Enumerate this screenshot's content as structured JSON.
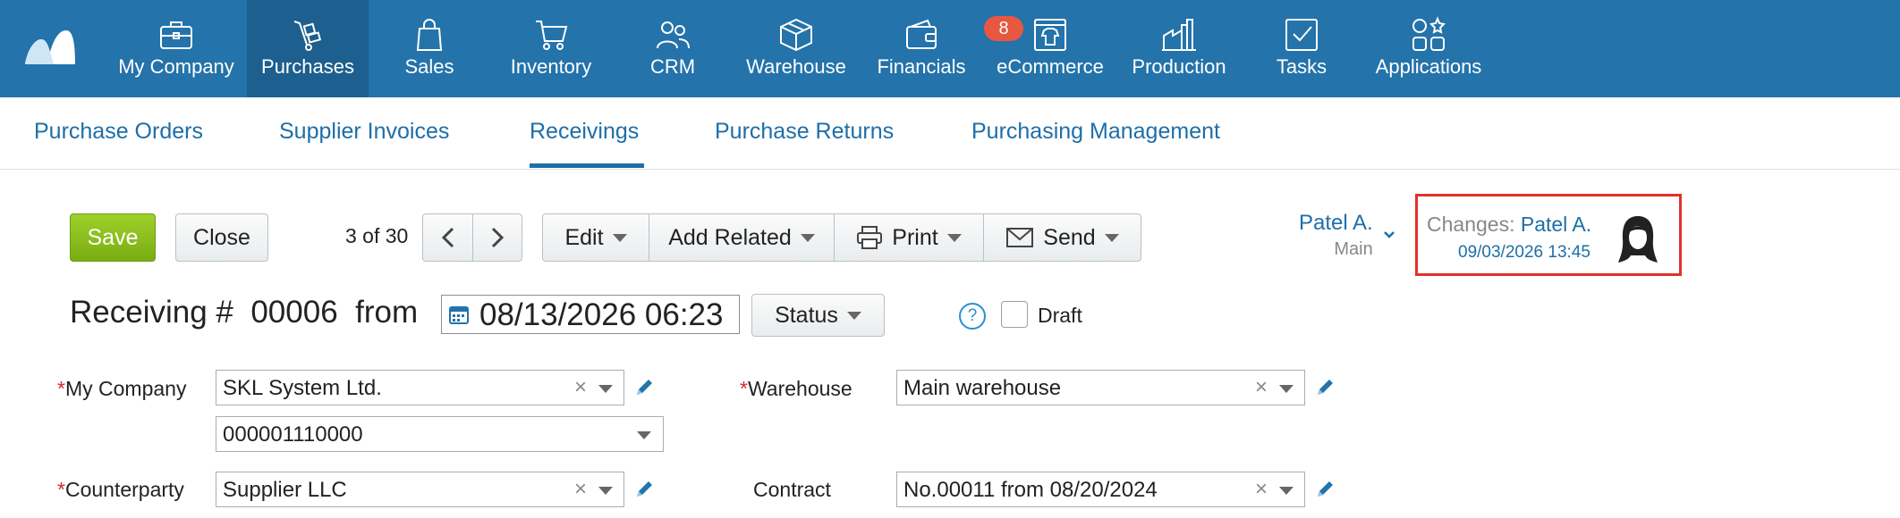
{
  "nav": [
    {
      "label": "My Company",
      "icon": "briefcase-icon"
    },
    {
      "label": "Purchases",
      "icon": "hand-truck-icon",
      "active": true
    },
    {
      "label": "Sales",
      "icon": "shopping-bag-icon"
    },
    {
      "label": "Inventory",
      "icon": "cart-icon"
    },
    {
      "label": "CRM",
      "icon": "people-icon"
    },
    {
      "label": "Warehouse",
      "icon": "box-icon"
    },
    {
      "label": "Financials",
      "icon": "wallet-icon"
    },
    {
      "label": "eCommerce",
      "icon": "store-icon"
    },
    {
      "label": "Production",
      "icon": "factory-icon"
    },
    {
      "label": "Tasks",
      "icon": "check-inbox-icon"
    },
    {
      "label": "Applications",
      "icon": "apps-grid-icon"
    }
  ],
  "tasks_badge": "8",
  "subnav": [
    {
      "label": "Purchase Orders"
    },
    {
      "label": "Supplier Invoices"
    },
    {
      "label": "Receivings",
      "active": true
    },
    {
      "label": "Purchase Returns"
    },
    {
      "label": "Purchasing Management"
    }
  ],
  "toolbar": {
    "save": "Save",
    "close": "Close",
    "counter": "3 of 30",
    "edit": "Edit",
    "add_related": "Add Related",
    "print": "Print",
    "send": "Send"
  },
  "user": {
    "name": "Patel A.",
    "sub": "Main"
  },
  "changes": {
    "label": "Changes:",
    "name": "Patel A.",
    "date": "09/03/2026 13:45"
  },
  "doc": {
    "prefix": "Receiving #",
    "number": "00006",
    "from": "from",
    "date": "08/13/2026 06:23",
    "status": "Status",
    "draft": "Draft",
    "help": "?"
  },
  "form": {
    "company_label": "My Company",
    "company": "SKL System Ltd.",
    "company_code": "000001110000",
    "counterparty_label": "Counterparty",
    "counterparty": "Supplier LLC",
    "warehouse_label": "Warehouse",
    "warehouse": "Main warehouse",
    "contract_label": "Contract",
    "contract": "No.00011 from 08/20/2024"
  },
  "colors": {
    "nav_bg": "#2473aa",
    "nav_active": "#1d5f8e",
    "accent": "#1e6ea8",
    "save": "#8bc01f",
    "badge": "#e8573f",
    "highlight": "#e0322b"
  }
}
